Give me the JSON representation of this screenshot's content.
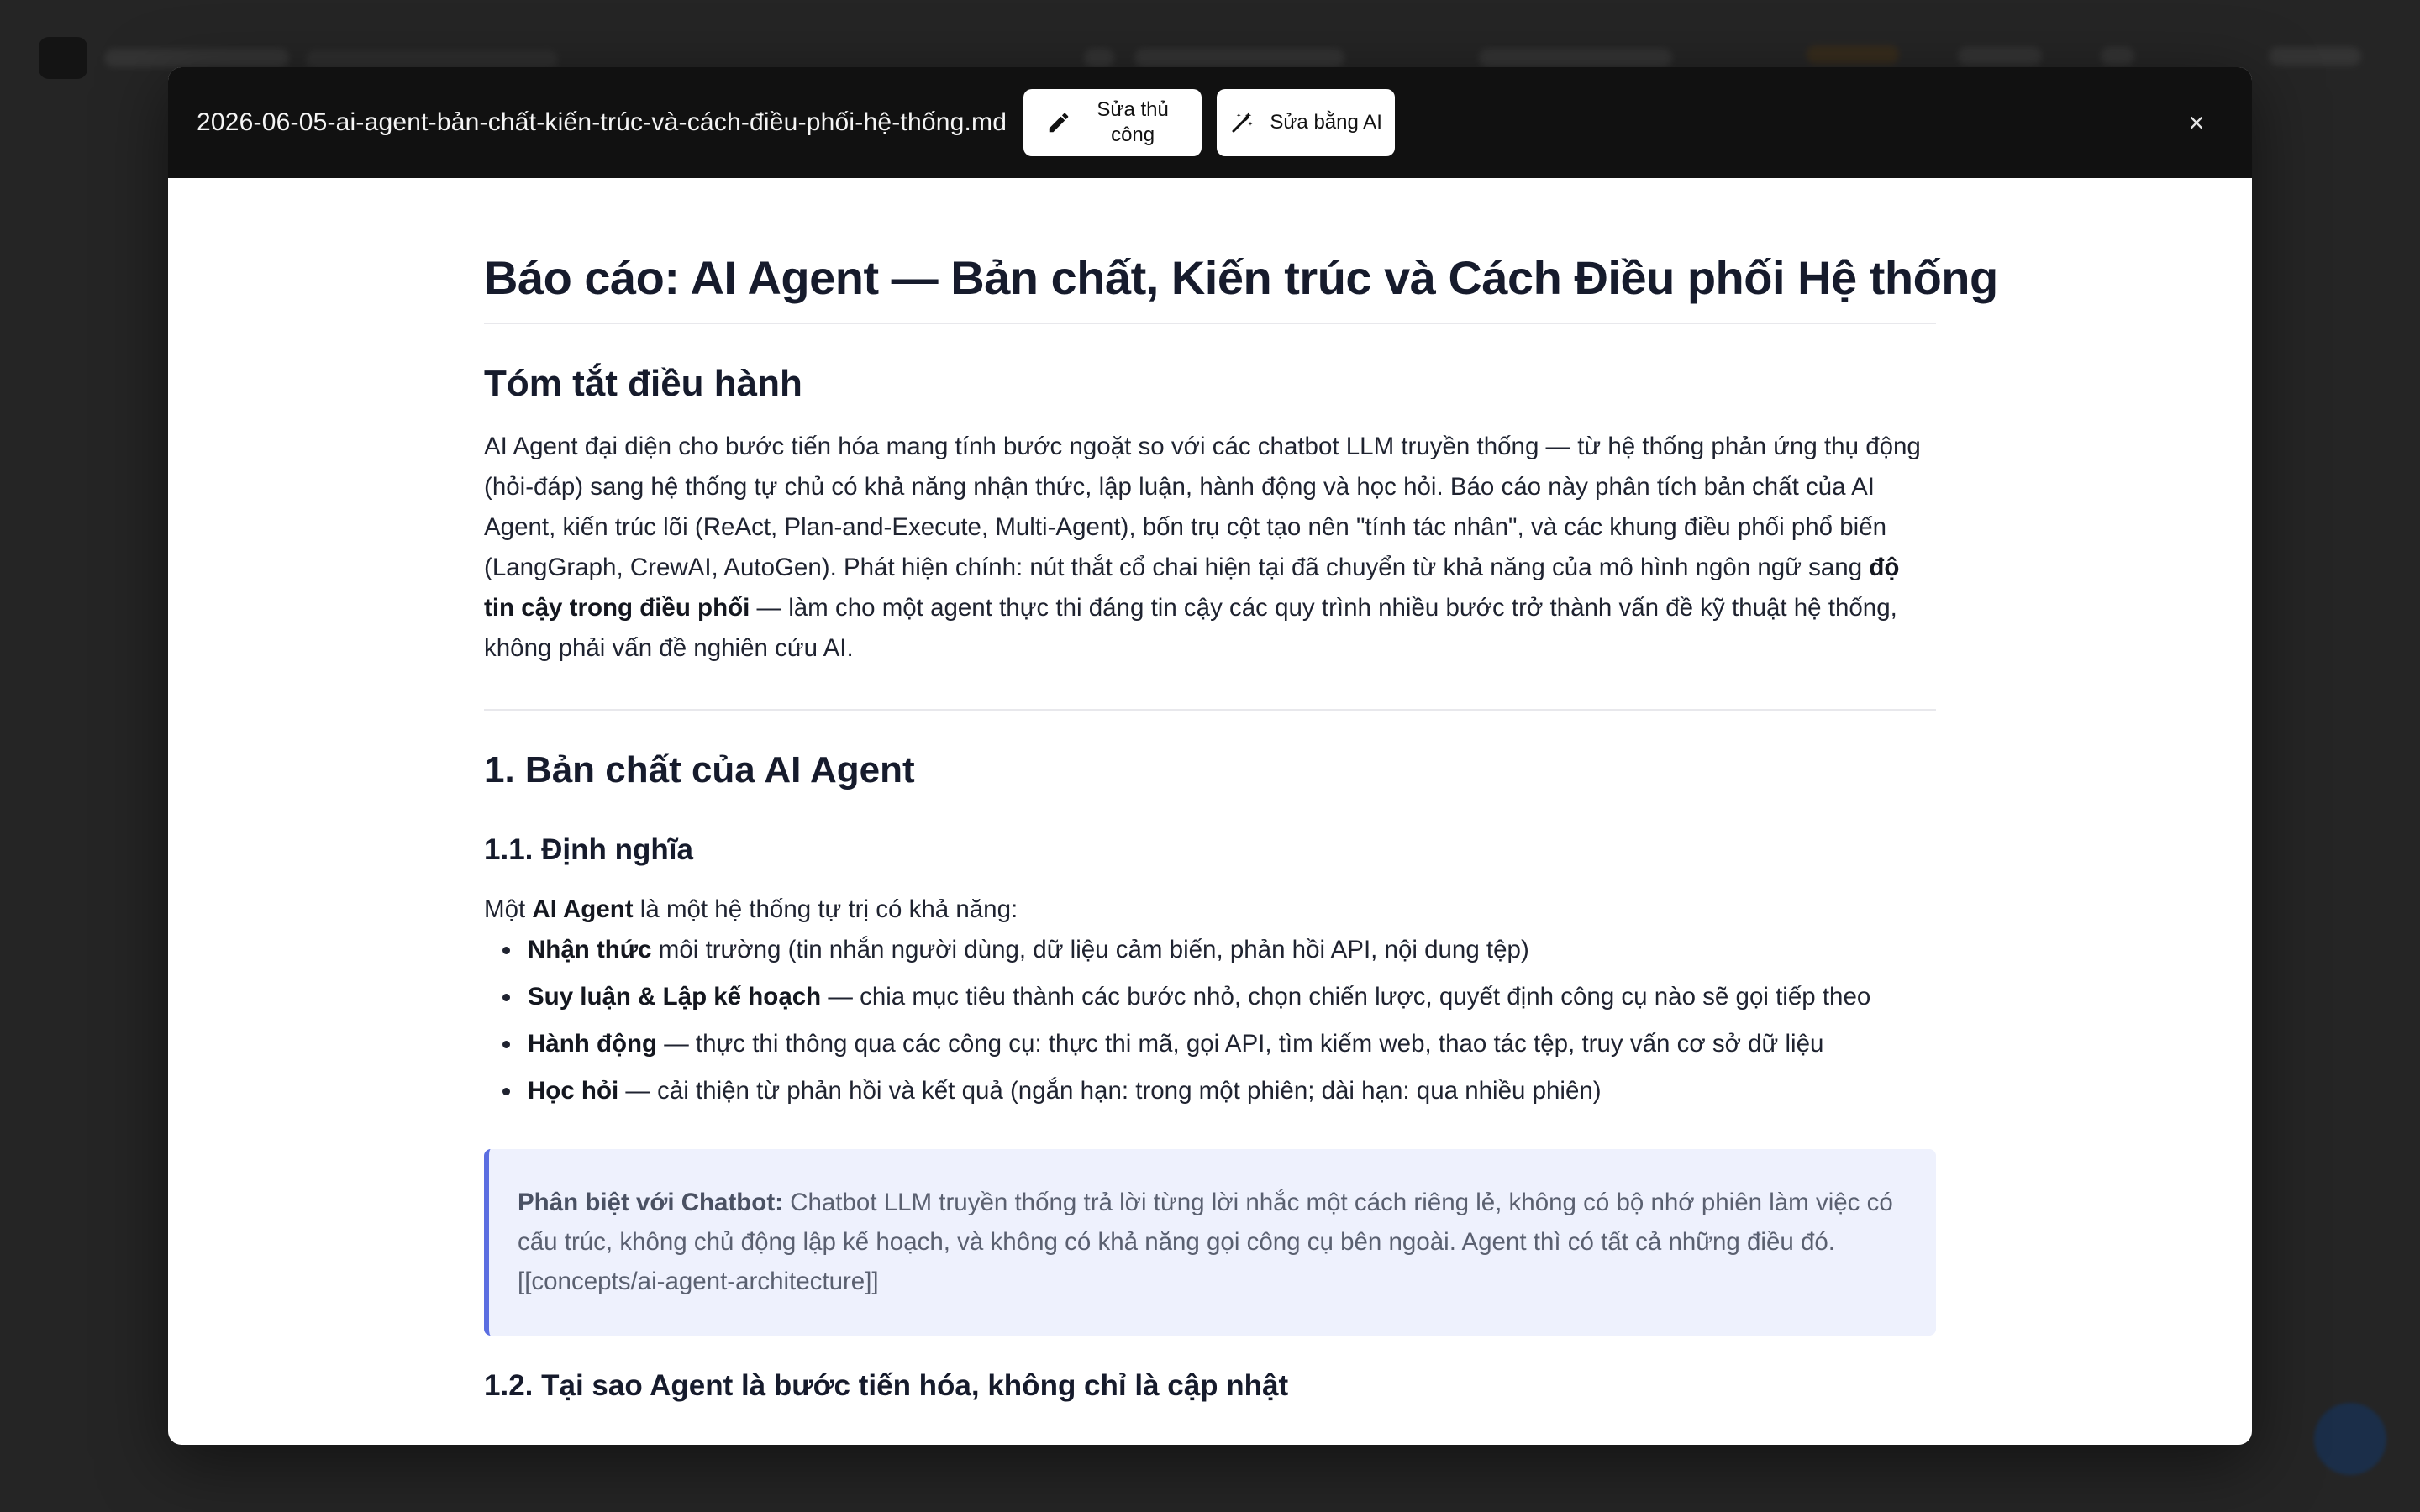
{
  "modal": {
    "filename": "2026-06-05-ai-agent-bản-chất-kiến-trúc-và-cách-điều-phối-hệ-thống.md",
    "edit_manual_label": "Sửa thủ công",
    "edit_ai_label": "Sửa bằng AI",
    "close_glyph": "×"
  },
  "doc": {
    "title": "Báo cáo: AI Agent — Bản chất, Kiến trúc và Cách Điều phối Hệ thống",
    "summary_heading": "Tóm tắt điều hành",
    "summary_text": "AI Agent đại diện cho bước tiến hóa mang tính bước ngoặt so với các chatbot LLM truyền thống — từ hệ thống phản ứng thụ động (hỏi-đáp) sang hệ thống tự chủ có khả năng nhận thức, lập luận, hành động và học hỏi. Báo cáo này phân tích bản chất của AI Agent, kiến trúc lõi (ReAct, Plan-and-Execute, Multi-Agent), bốn trụ cột tạo nên \"tính tác nhân\", và các khung điều phối phổ biến (LangGraph, CrewAI, AutoGen). Phát hiện chính: nút thắt cổ chai hiện tại đã chuyển từ khả năng của mô hình ngôn ngữ sang",
    "summary_bold": "độ tin cậy trong điều phối",
    "summary_tail": "— làm cho một agent thực thi đáng tin cậy các quy trình nhiều bước trở thành vấn đề kỹ thuật hệ thống, không phải vấn đề nghiên cứu AI.",
    "section1_heading": "1. Bản chất của AI Agent",
    "sub11_heading": "1.1. Định nghĩa",
    "def_prefix": "Một",
    "def_bold": "AI Agent",
    "def_suffix": "là một hệ thống tự trị có khả năng:",
    "capabilities": [
      {
        "bold": "Nhận thức",
        "text": "môi trường (tin nhắn người dùng, dữ liệu cảm biến, phản hồi API, nội dung tệp)"
      },
      {
        "bold": "Suy luận & Lập kế hoạch",
        "text": "— chia mục tiêu thành các bước nhỏ, chọn chiến lược, quyết định công cụ nào sẽ gọi tiếp theo"
      },
      {
        "bold": "Hành động",
        "text": "— thực thi thông qua các công cụ: thực thi mã, gọi API, tìm kiếm web, thao tác tệp, truy vấn cơ sở dữ liệu"
      },
      {
        "bold": "Học hỏi",
        "text": "— cải thiện từ phản hồi và kết quả (ngắn hạn: trong một phiên; dài hạn: qua nhiều phiên)"
      }
    ],
    "quote_bold": "Phân biệt với Chatbot:",
    "quote_text": "Chatbot LLM truyền thống trả lời từng lời nhắc một cách riêng lẻ, không có bộ nhớ phiên làm việc có cấu trúc, không chủ động lập kế hoạch, và không có khả năng gọi công cụ bên ngoài. Agent thì có tất cả những điều đó. [[concepts/ai-agent-architecture]]",
    "sub12_heading": "1.2. Tại sao Agent là bước tiến hóa, không chỉ là cập nhật"
  }
}
